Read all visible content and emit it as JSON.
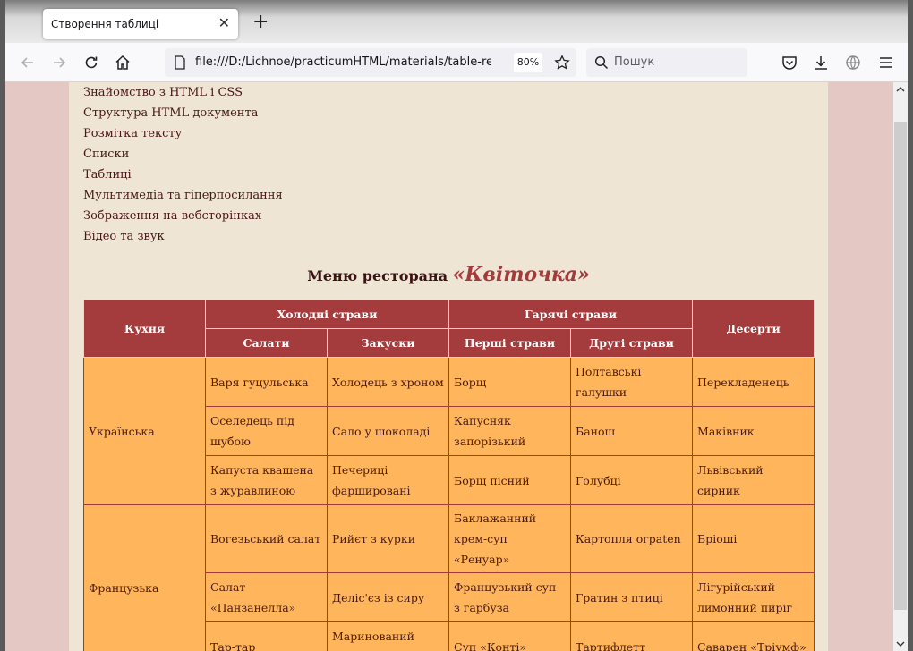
{
  "tab": {
    "title": "Створення таблиці"
  },
  "toolbar": {
    "url": "file:///D:/Lichnoe/practicumHTML/materials/table-rez/tabl",
    "zoom": "80%",
    "search_placeholder": "Пошук"
  },
  "nav": {
    "items": [
      "Знайомство з HTML і CSS",
      "Структура HTML документа",
      "Розмітка тексту",
      "Списки",
      "Таблиці",
      "Мультимедіа та гіперпосилання",
      "Зображення на вебсторінках",
      "Відео та звук"
    ]
  },
  "page": {
    "heading": "Меню ресторана",
    "brand": "«Квіточка»"
  },
  "table": {
    "h_cuisine": "Кухня",
    "h_cold": "Холодні страви",
    "h_hot": "Гарячі страви",
    "h_dessert": "Десерти",
    "h_salads": "Салати",
    "h_snacks": "Закуски",
    "h_first": "Перші страви",
    "h_second": "Другі страви",
    "groups": [
      {
        "name": "Українська",
        "rows": [
          [
            "Варя гуцульська",
            "Холодець з хроном",
            "Борщ",
            "Полтавські галушки",
            "Перекладенець"
          ],
          [
            "Оселедець під шубою",
            "Сало у шоколаді",
            "Капусняк запорізький",
            "Банош",
            "Маківник"
          ],
          [
            "Капуста квашена з журавлиною",
            "Печериці фаршировані",
            "Борщ пісний",
            "Голубці",
            "Львівський сирник"
          ]
        ]
      },
      {
        "name": "Французька",
        "rows": [
          [
            "Вогезьський салат",
            "Рийєт з курки",
            "Баклажанний крем-суп «Ренуар»",
            "Картопля ограten",
            "Бріоші"
          ],
          [
            "Салат «Панзанелла»",
            "Деліс'єз із сиру",
            "Французький суп з гарбуза",
            "Гратин з птиці",
            "Лігурійський лимонний пиріг"
          ],
          [
            "Тар-тар",
            "Маринований лосось",
            "Суп «Конті»",
            "Тартифлетт",
            "Саварен «Тріумф»"
          ]
        ]
      }
    ]
  },
  "colors": {
    "header_bg": "#a43b3c",
    "cell_bg": "#ffb55c",
    "page_bg": "#eee5d4",
    "outer_bg": "#e4c8c4"
  }
}
